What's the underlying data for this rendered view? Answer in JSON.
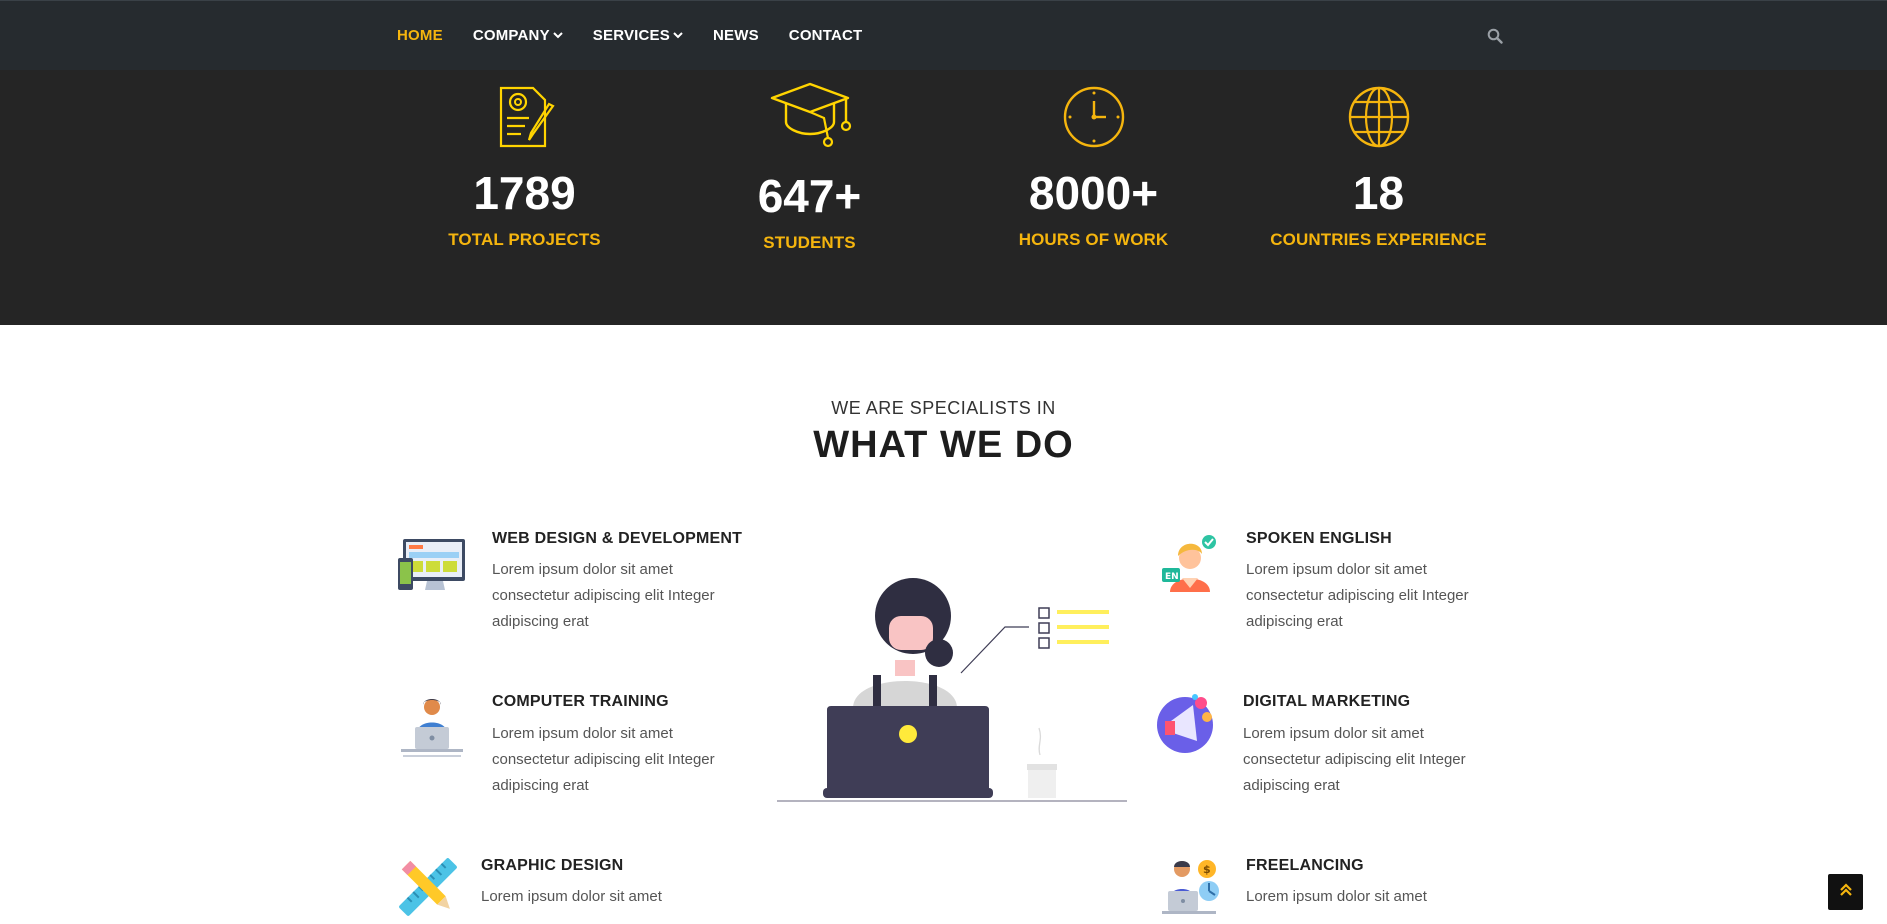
{
  "nav": {
    "items": [
      {
        "label": "HOME",
        "active": true,
        "dropdown": false
      },
      {
        "label": "COMPANY",
        "active": false,
        "dropdown": true
      },
      {
        "label": "SERVICES",
        "active": false,
        "dropdown": true
      },
      {
        "label": "NEWS",
        "active": false,
        "dropdown": false
      },
      {
        "label": "CONTACT",
        "active": false,
        "dropdown": false
      }
    ],
    "search_icon": "search-icon"
  },
  "counters": [
    {
      "value": "1789",
      "label": "TOTAL PROJECTS",
      "icon": "certificate-icon"
    },
    {
      "value": "647+",
      "label": "STUDENTS",
      "icon": "graduation-cap-icon"
    },
    {
      "value": "8000+",
      "label": "HOURS OF WORK",
      "icon": "clock-icon"
    },
    {
      "value": "18",
      "label": "COUNTRIES EXPERIENCE",
      "icon": "globe-icon"
    }
  ],
  "section": {
    "subtitle": "WE ARE SPECIALISTS IN",
    "title": "WHAT WE DO"
  },
  "services": [
    {
      "title": "WEB DESIGN & DEVELOPMENT",
      "desc": "Lorem ipsum dolor sit amet consectetur adipiscing elit Integer adipiscing erat",
      "icon": "web-design-icon"
    },
    {
      "title": "COMPUTER TRAINING",
      "desc": "Lorem ipsum dolor sit amet consectetur adipiscing elit Integer adipiscing erat",
      "icon": "computer-training-icon"
    },
    {
      "title": "GRAPHIC DESIGN",
      "desc": "Lorem ipsum dolor sit amet",
      "icon": "graphic-design-icon"
    },
    {
      "title": "SPOKEN ENGLISH",
      "desc": "Lorem ipsum dolor sit amet consectetur adipiscing elit Integer adipiscing erat",
      "icon": "spoken-english-icon"
    },
    {
      "title": "DIGITAL MARKETING",
      "desc": "Lorem ipsum dolor sit amet consectetur adipiscing elit Integer adipiscing erat",
      "icon": "digital-marketing-icon"
    },
    {
      "title": "FREELANCING",
      "desc": "Lorem ipsum dolor sit amet",
      "icon": "freelancing-icon"
    }
  ],
  "colors": {
    "accent": "#f5b50e",
    "nav_bg": "#262b2f",
    "counter_bg": "#252525",
    "icon_yellow": "#ffd400"
  }
}
